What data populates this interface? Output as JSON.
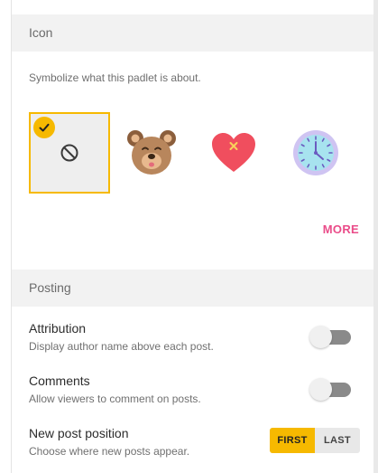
{
  "icon_section": {
    "header": "Icon",
    "description": "Symbolize what this padlet is about.",
    "options": [
      {
        "name": "none",
        "selected": true
      },
      {
        "name": "bear",
        "selected": false
      },
      {
        "name": "heart",
        "selected": false
      },
      {
        "name": "clock",
        "selected": false
      }
    ],
    "more_label": "MORE"
  },
  "posting_section": {
    "header": "Posting",
    "attribution": {
      "title": "Attribution",
      "subtitle": "Display author name above each post.",
      "enabled": false
    },
    "comments": {
      "title": "Comments",
      "subtitle": "Allow viewers to comment on posts.",
      "enabled": false
    },
    "new_post_position": {
      "title": "New post position",
      "subtitle": "Choose where new posts appear.",
      "options": [
        "FIRST",
        "LAST"
      ],
      "selected": "FIRST"
    }
  },
  "colors": {
    "accent": "#f6b900",
    "link": "#ea4c89",
    "toggle_track": "#8a8a8a"
  }
}
